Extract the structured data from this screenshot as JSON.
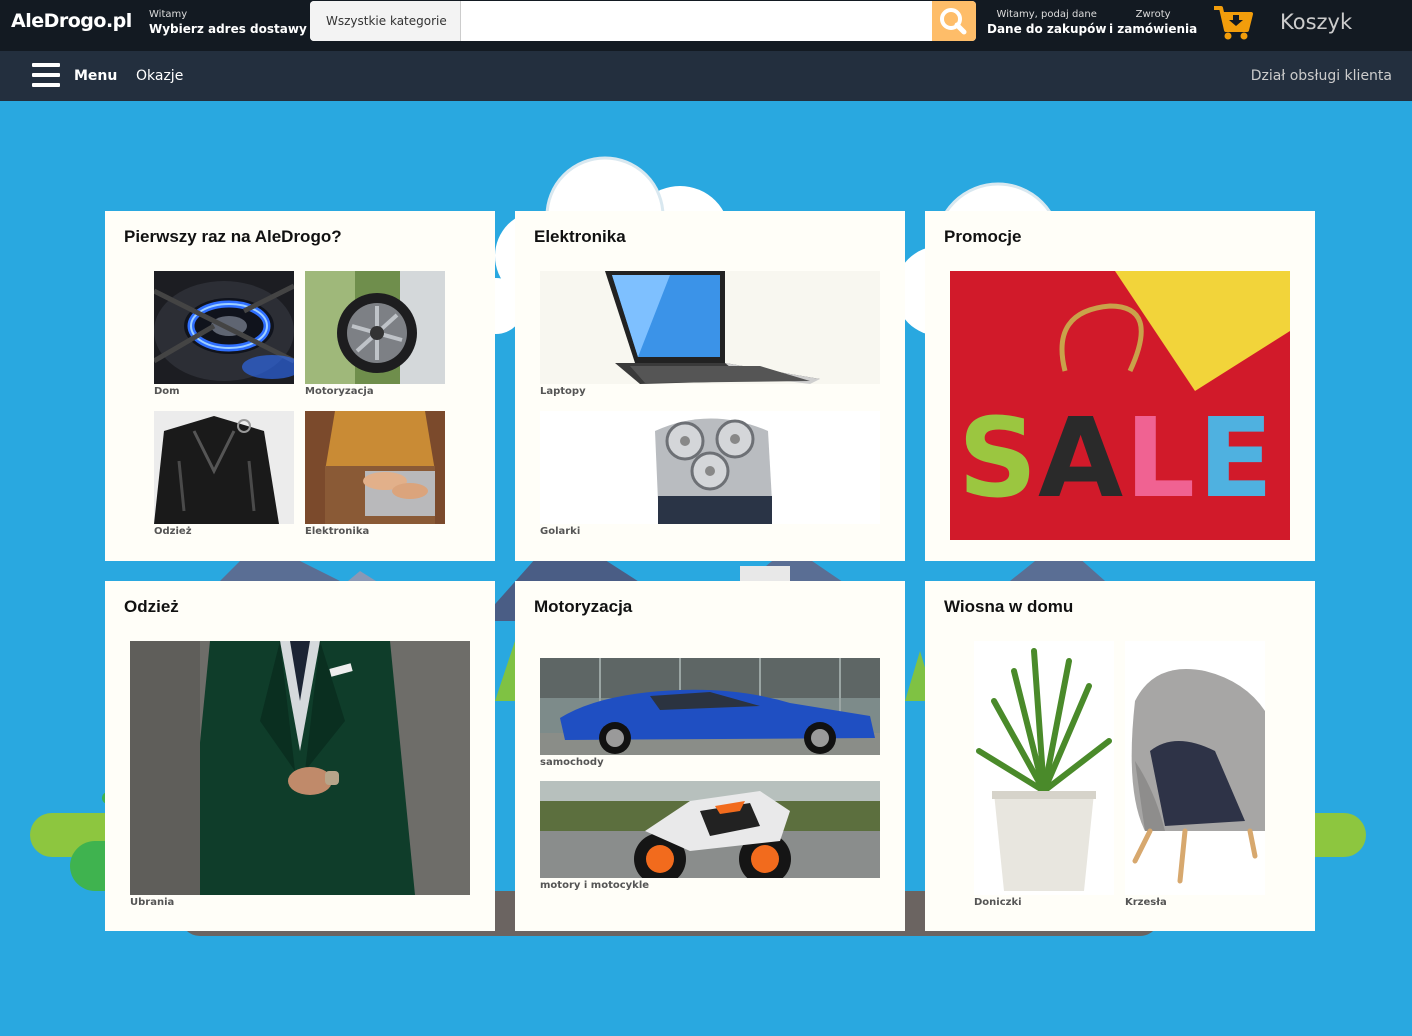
{
  "header": {
    "logo": "AleDrogo.pl",
    "deliver_small": "Witamy",
    "deliver_strong": "Wybierz adres dostawy",
    "search_category": "Wszystkie kategorie",
    "search_value": "",
    "account_small": "Witamy, podaj dane",
    "account_strong": "Dane do zakupów",
    "orders_small": "Zwroty",
    "orders_strong": "i zamówienia",
    "cart_label": "Koszyk",
    "accent_color": "#febd69",
    "icons": [
      "search-icon",
      "cart-icon"
    ]
  },
  "nav": {
    "menu_label": "Menu",
    "deals_label": "Okazje",
    "service_label": "Dział obsługi klienta",
    "icons": [
      "hamburger-icon"
    ]
  },
  "cards": [
    {
      "title": "Pierwszy raz na AleDrogo?",
      "items": [
        "Dom",
        "Motoryzacja",
        "Odzież",
        "Elektronika"
      ]
    },
    {
      "title": "Elektronika",
      "items": [
        "Laptopy",
        "Golarki"
      ]
    },
    {
      "title": "Promocje",
      "items": [
        "SALE"
      ]
    },
    {
      "title": "Odzież",
      "items": [
        "Ubrania"
      ]
    },
    {
      "title": "Motoryzacja",
      "items": [
        "samochody",
        "motory i motocykle"
      ]
    },
    {
      "title": "Wiosna w domu",
      "items": [
        "Doniczki",
        "Krzesła"
      ]
    }
  ]
}
